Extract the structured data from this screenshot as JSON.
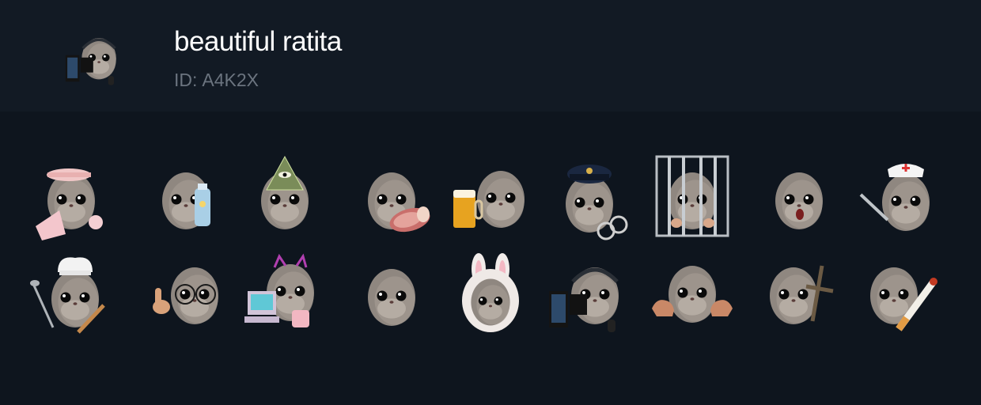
{
  "pack": {
    "title": "beautiful ratita",
    "id_label": "ID:",
    "id_value": "A4K2X",
    "thumbnail_icon": "hamster-gamer-pc-icon"
  },
  "stickers": [
    {
      "name": "hamster-sleep-mask-sticker",
      "prop": "sleep-mask"
    },
    {
      "name": "hamster-baby-bottle-sticker",
      "prop": "bottle"
    },
    {
      "name": "hamster-illuminati-sticker",
      "prop": "pyramid"
    },
    {
      "name": "hamster-ham-sticker",
      "prop": "ham"
    },
    {
      "name": "hamster-beer-sticker",
      "prop": "beer"
    },
    {
      "name": "hamster-police-sticker",
      "prop": "police"
    },
    {
      "name": "hamster-jail-sticker",
      "prop": "jail"
    },
    {
      "name": "hamster-shocked-sticker",
      "prop": "shocked"
    },
    {
      "name": "hamster-nurse-sticker",
      "prop": "nurse"
    },
    {
      "name": "hamster-chef-sticker",
      "prop": "chef"
    },
    {
      "name": "hamster-nerd-glasses-sticker",
      "prop": "nerd"
    },
    {
      "name": "hamster-vaporwave-sticker",
      "prop": "vapor"
    },
    {
      "name": "hamster-plain-sticker",
      "prop": "plain"
    },
    {
      "name": "hamster-bunny-hood-sticker",
      "prop": "bunny"
    },
    {
      "name": "hamster-gamer-pc-sticker",
      "prop": "gamer"
    },
    {
      "name": "hamster-muscles-sticker",
      "prop": "muscles"
    },
    {
      "name": "hamster-cross-sticker",
      "prop": "cross"
    },
    {
      "name": "hamster-cigarette-sticker",
      "prop": "cigarette"
    }
  ]
}
